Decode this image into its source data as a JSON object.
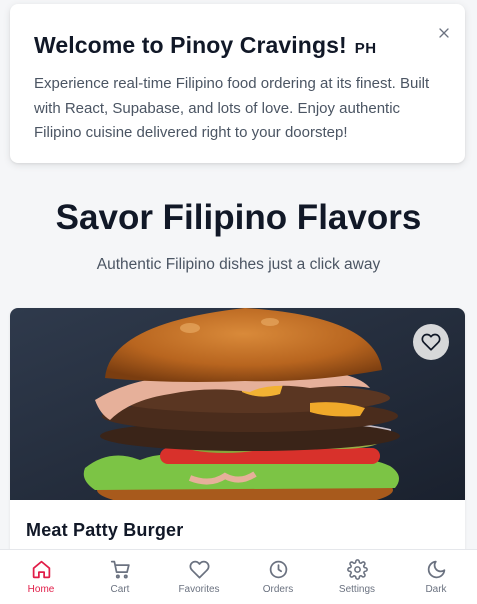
{
  "welcome": {
    "title": "Welcome to Pinoy Cravings!",
    "flag": "PH",
    "text": "Experience real-time Filipino food ordering at its finest. Built with React, Supabase, and lots of love. Enjoy authentic Filipino cuisine delivered right to your doorstep!"
  },
  "hero": {
    "title": "Savor Filipino Flavors",
    "subtitle": "Authentic Filipino dishes just a click away"
  },
  "product": {
    "name": "Meat Patty Burger"
  },
  "nav": {
    "items": [
      {
        "label": "Home",
        "icon": "home-icon",
        "active": true
      },
      {
        "label": "Cart",
        "icon": "cart-icon",
        "active": false
      },
      {
        "label": "Favorites",
        "icon": "heart-icon",
        "active": false
      },
      {
        "label": "Orders",
        "icon": "clock-icon",
        "active": false
      },
      {
        "label": "Settings",
        "icon": "gear-icon",
        "active": false
      },
      {
        "label": "Dark",
        "icon": "moon-icon",
        "active": false
      }
    ]
  },
  "colors": {
    "accent": "#e11d48",
    "background": "#f5f6f8",
    "text": "#111827",
    "muted": "#6b7280"
  }
}
